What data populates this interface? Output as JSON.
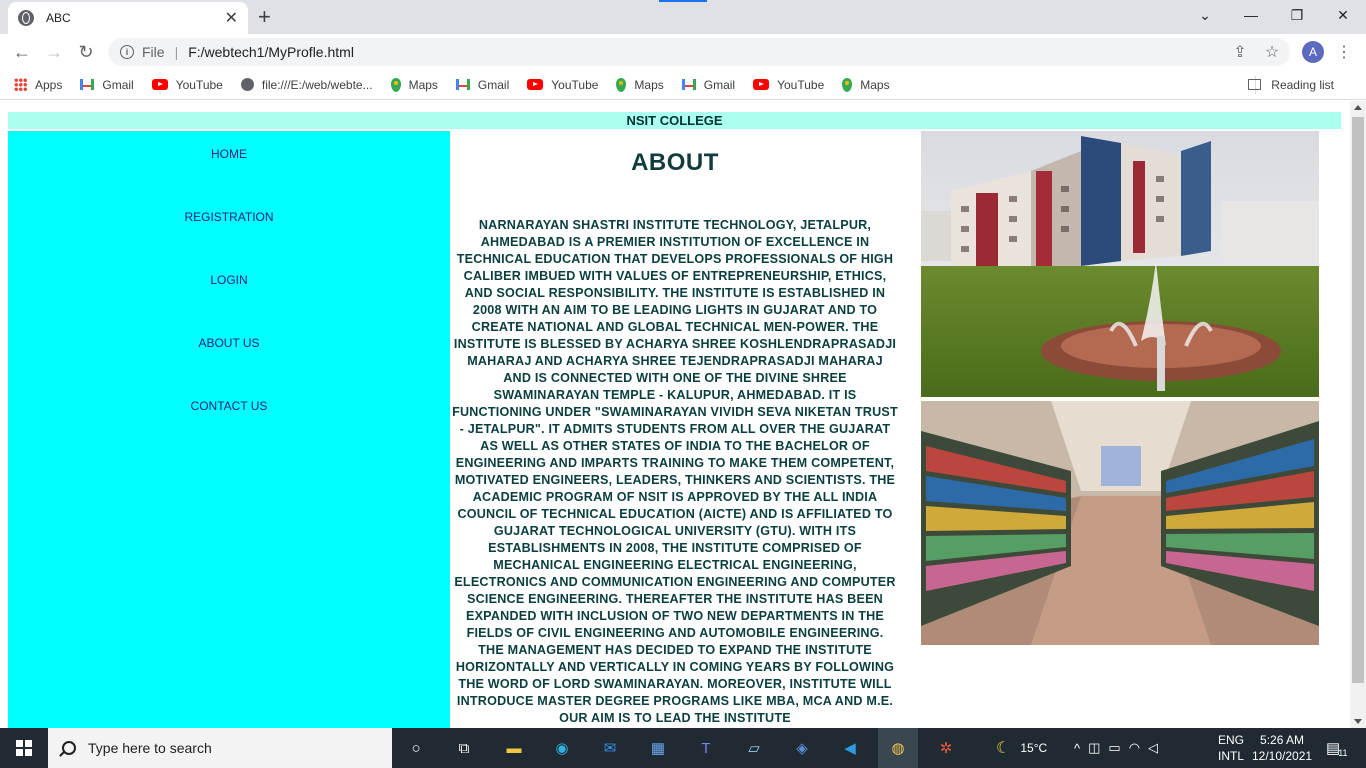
{
  "browser": {
    "tab_title": "ABC",
    "url_scheme": "File",
    "url": "F:/webtech1/MyProfle.html",
    "avatar_initial": "A",
    "bookmarks": [
      {
        "label": "Apps",
        "icon": "apps-icon"
      },
      {
        "label": "Gmail",
        "icon": "gmail-icon"
      },
      {
        "label": "YouTube",
        "icon": "youtube-icon"
      },
      {
        "label": "file:///E:/web/webte...",
        "icon": "globe-icon"
      },
      {
        "label": "Maps",
        "icon": "maps-icon"
      },
      {
        "label": "Gmail",
        "icon": "gmail-icon"
      },
      {
        "label": "YouTube",
        "icon": "youtube-icon"
      },
      {
        "label": "Maps",
        "icon": "maps-icon"
      },
      {
        "label": "Gmail",
        "icon": "gmail-icon"
      },
      {
        "label": "YouTube",
        "icon": "youtube-icon"
      },
      {
        "label": "Maps",
        "icon": "maps-icon"
      }
    ],
    "reading_list": "Reading list"
  },
  "page": {
    "header": "NSIT COLLEGE",
    "nav": [
      "HOME",
      "REGISTRATION",
      "LOGIN",
      "ABOUT US",
      "CONTACT US"
    ],
    "about_title": "ABOUT",
    "about_text": "NARNARAYAN SHASTRI INSTITUTE TECHNOLOGY, JETALPUR, AHMEDABAD IS A PREMIER INSTITUTION OF EXCELLENCE IN TECHNICAL EDUCATION THAT DEVELOPS PROFESSIONALS OF HIGH CALIBER IMBUED WITH VALUES OF ENTREPRENEURSHIP, ETHICS, AND SOCIAL RESPONSIBILITY. THE INSTITUTE IS ESTABLISHED IN 2008 WITH AN AIM TO BE LEADING LIGHTS IN GUJARAT AND TO CREATE NATIONAL AND GLOBAL TECHNICAL MEN-POWER. THE INSTITUTE IS BLESSED BY ACHARYA SHREE KOSHLENDRAPRASADJI MAHARAJ AND ACHARYA SHREE TEJENDRAPRASADJI MAHARAJ AND IS CONNECTED WITH ONE OF THE DIVINE SHREE SWAMINARAYAN TEMPLE - KALUPUR, AHMEDABAD. IT IS FUNCTIONING UNDER \"SWAMINARAYAN VIVIDH SEVA NIKETAN TRUST - JETALPUR\". IT ADMITS STUDENTS FROM ALL OVER THE GUJARAT AS WELL AS OTHER STATES OF INDIA TO THE BACHELOR OF ENGINEERING AND IMPARTS TRAINING TO MAKE THEM COMPETENT, MOTIVATED ENGINEERS, LEADERS, THINKERS AND SCIENTISTS. THE ACADEMIC PROGRAM OF NSIT IS APPROVED BY THE ALL INDIA COUNCIL OF TECHNICAL EDUCATION (AICTE) AND IS AFFILIATED TO GUJARAT TECHNOLOGICAL UNIVERSITY (GTU). WITH ITS ESTABLISHMENTS IN 2008, THE INSTITUTE COMPRISED OF MECHANICAL ENGINEERING ELECTRICAL ENGINEERING, ELECTRONICS AND COMMUNICATION ENGINEERING AND COMPUTER SCIENCE ENGINEERING. THEREAFTER THE INSTITUTE HAS BEEN EXPANDED WITH INCLUSION OF TWO NEW DEPARTMENTS IN THE FIELDS OF CIVIL ENGINEERING AND AUTOMOBILE ENGINEERING. THE MANAGEMENT HAS DECIDED TO EXPAND THE INSTITUTE HORIZONTALLY AND VERTICALLY IN COMING YEARS BY FOLLOWING THE WORD OF LORD SWAMINARAYAN. MOREOVER, INSTITUTE WILL INTRODUCE MASTER DEGREE PROGRAMS LIKE MBA, MCA AND M.E. OUR AIM IS TO LEAD THE INSTITUTE",
    "images": [
      "campus-building-photo",
      "library-bookshelves-photo"
    ]
  },
  "taskbar": {
    "search_placeholder": "Type here to search",
    "temperature": "15°C",
    "lang_top": "ENG",
    "lang_bottom": "INTL",
    "time": "5:26 AM",
    "date": "12/10/2021",
    "notification_count": "11"
  }
}
